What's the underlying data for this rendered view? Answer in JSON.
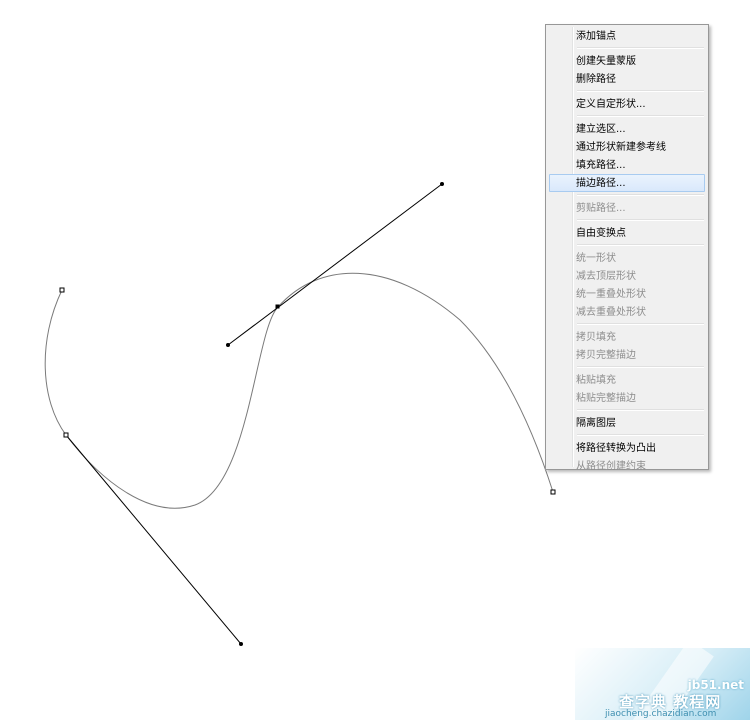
{
  "context_menu": {
    "items": [
      {
        "label": "添加锚点",
        "state": "enabled"
      },
      {
        "separator": true
      },
      {
        "label": "创建矢量蒙版",
        "state": "enabled"
      },
      {
        "label": "删除路径",
        "state": "enabled"
      },
      {
        "separator": true
      },
      {
        "label": "定义自定形状...",
        "state": "enabled"
      },
      {
        "separator": true
      },
      {
        "label": "建立选区...",
        "state": "enabled"
      },
      {
        "label": "通过形状新建参考线",
        "state": "enabled"
      },
      {
        "label": "填充路径...",
        "state": "enabled"
      },
      {
        "label": "描边路径...",
        "state": "highlighted"
      },
      {
        "separator": true
      },
      {
        "label": "剪贴路径...",
        "state": "disabled"
      },
      {
        "separator": true
      },
      {
        "label": "自由变换点",
        "state": "enabled"
      },
      {
        "separator": true
      },
      {
        "label": "统一形状",
        "state": "disabled"
      },
      {
        "label": "减去顶层形状",
        "state": "disabled"
      },
      {
        "label": "统一重叠处形状",
        "state": "disabled"
      },
      {
        "label": "减去重叠处形状",
        "state": "disabled"
      },
      {
        "separator": true
      },
      {
        "label": "拷贝填充",
        "state": "disabled"
      },
      {
        "label": "拷贝完整描边",
        "state": "disabled"
      },
      {
        "separator": true
      },
      {
        "label": "粘贴填充",
        "state": "disabled"
      },
      {
        "label": "粘贴完整描边",
        "state": "disabled"
      },
      {
        "separator": true
      },
      {
        "label": "隔离图层",
        "state": "enabled"
      },
      {
        "separator": true
      },
      {
        "label": "将路径转换为凸出",
        "state": "enabled"
      },
      {
        "label": "从路径创建约束",
        "state": "disabled"
      }
    ]
  },
  "watermark": {
    "site": "jb51.net",
    "title": "查字典 教程网",
    "url": "jiaocheng.chazidian.com"
  },
  "colors": {
    "path_stroke": "#7a7a7a",
    "handle_line": "#000000",
    "menu_background": "#f0f0f0",
    "menu_highlight": "#d9e8fb"
  }
}
